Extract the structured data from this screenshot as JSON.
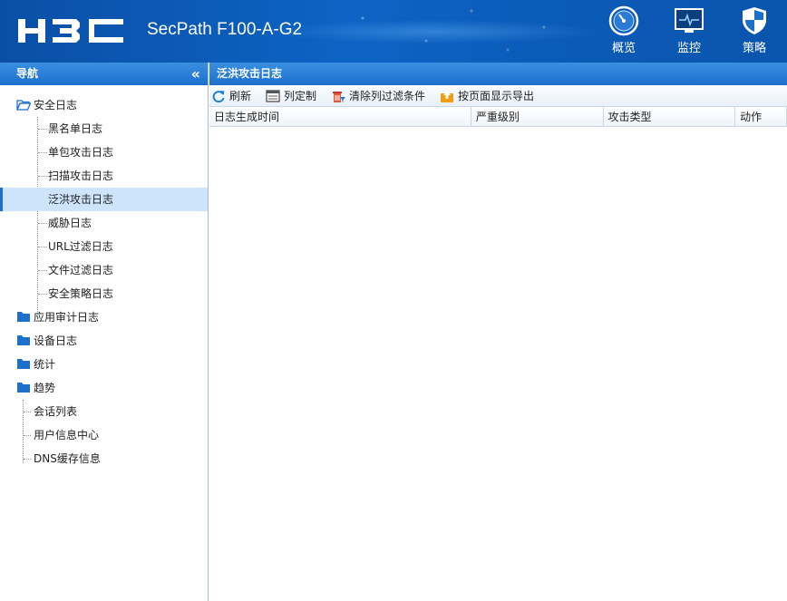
{
  "header": {
    "logo_text": "H3C",
    "device_name": "SecPath F100-A-G2",
    "nav": [
      {
        "label": "概览",
        "icon": "gauge-icon"
      },
      {
        "label": "监控",
        "icon": "monitor-icon"
      },
      {
        "label": "策略",
        "icon": "shield-icon"
      }
    ]
  },
  "sidebar": {
    "title": "导航",
    "collapse_glyph": "«",
    "tree": {
      "security_log": {
        "label": "安全日志",
        "children": [
          "黑名单日志",
          "单包攻击日志",
          "扫描攻击日志",
          "泛洪攻击日志",
          "威胁日志",
          "URL过滤日志",
          "文件过滤日志",
          "安全策略日志"
        ]
      },
      "app_audit_log": {
        "label": "应用审计日志"
      },
      "device_log": {
        "label": "设备日志"
      },
      "stats": {
        "label": "统计"
      },
      "trend": {
        "label": "趋势"
      },
      "session_list": {
        "label": "会话列表"
      },
      "user_info_center": {
        "label": "用户信息中心"
      },
      "dns_cache": {
        "label": "DNS缓存信息"
      }
    },
    "selected": "泛洪攻击日志"
  },
  "main": {
    "title": "泛洪攻击日志",
    "toolbar": {
      "refresh": "刷新",
      "columns": "列定制",
      "clear_filters": "清除列过滤条件",
      "export": "按页面显示导出"
    },
    "columns": [
      "日志生成时间",
      "严重级别",
      "攻击类型",
      "动作"
    ]
  },
  "colors": {
    "header_blue": "#0d64c4",
    "panel_blue": "#1d6fcc",
    "selected_bg": "#cde4fb",
    "folder": "#1d6fcc"
  }
}
